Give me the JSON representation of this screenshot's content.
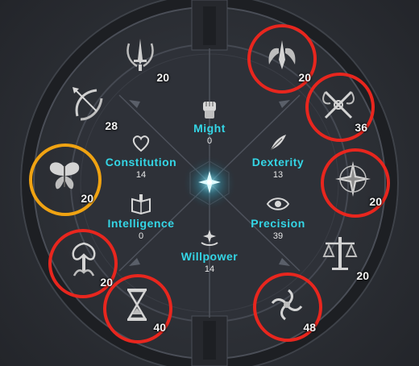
{
  "stats": {
    "might": {
      "label": "Might",
      "value": "0",
      "icon": "fist-icon"
    },
    "constitution": {
      "label": "Constitution",
      "value": "14",
      "icon": "heart-icon"
    },
    "dexterity": {
      "label": "Dexterity",
      "value": "13",
      "icon": "feather-icon"
    },
    "intelligence": {
      "label": "Intelligence",
      "value": "0",
      "icon": "book-icon"
    },
    "precision": {
      "label": "Precision",
      "value": "39",
      "icon": "eye-icon"
    },
    "willpower": {
      "label": "Willpower",
      "value": "14",
      "icon": "sparkle-hand-icon"
    }
  },
  "skills": {
    "top_left": {
      "value": "20",
      "icon": "sword-crest-icon"
    },
    "top_right": {
      "value": "20",
      "icon": "winged-blade-icon"
    },
    "upper_left": {
      "value": "28",
      "icon": "bow-icon"
    },
    "upper_right": {
      "value": "36",
      "icon": "crossed-blades-icon"
    },
    "left": {
      "value": "20",
      "icon": "butterfly-icon"
    },
    "right": {
      "value": "20",
      "icon": "compass-star-icon"
    },
    "lower_left": {
      "value": "20",
      "icon": "tree-icon"
    },
    "lower_right": {
      "value": "20",
      "icon": "scales-icon"
    },
    "bottom_left": {
      "value": "40",
      "icon": "hourglass-icon"
    },
    "bottom_right": {
      "value": "48",
      "icon": "vortex-icon"
    }
  },
  "highlights": {
    "red": "#e8261e",
    "yellow": "#f0a312",
    "accent": "#34d6e6"
  }
}
